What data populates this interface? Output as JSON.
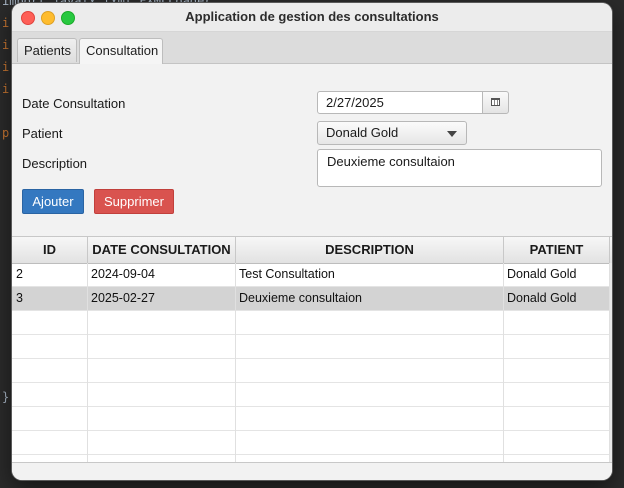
{
  "window": {
    "title": "Application de gestion des consultations"
  },
  "tabs": [
    {
      "label": "Patients"
    },
    {
      "label": "Consultation"
    }
  ],
  "active_tab": "Consultation",
  "form": {
    "date_label": "Date Consultation",
    "date_value": "2/27/2025",
    "patient_label": "Patient",
    "patient_value": "Donald Gold",
    "description_label": "Description",
    "description_value": "Deuxieme consultaion"
  },
  "buttons": {
    "add": "Ajouter",
    "delete": "Supprimer"
  },
  "table": {
    "columns": [
      "ID",
      "DATE CONSULTATION",
      "DESCRIPTION",
      "PATIENT"
    ],
    "rows": [
      {
        "id": "2",
        "date": "2024-09-04",
        "description": "Test Consultation",
        "patient": "Donald Gold"
      },
      {
        "id": "3",
        "date": "2025-02-27",
        "description": "Deuxieme consultaion",
        "patient": "Donald Gold"
      }
    ],
    "selected_row": 1
  },
  "colors": {
    "add_button": "#3478c0",
    "delete_button": "#d9534f",
    "selected_row": "#d3d3d3"
  },
  "icons": [
    "calendar-icon",
    "chevron-down-icon"
  ]
}
